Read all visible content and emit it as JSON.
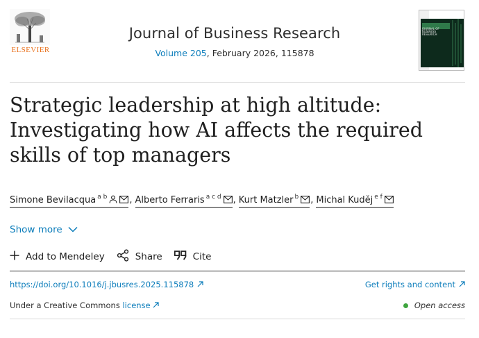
{
  "publisher": {
    "name": "ELSEVIER"
  },
  "journal": {
    "title": "Journal of Business Research",
    "volume_link": "Volume 205",
    "issue_info": ", February 2026, 115878",
    "cover_text": "JOURNAL OF BUSINESS RESEARCH"
  },
  "article": {
    "title_line1": "Strategic leadership at high altitude:",
    "title_line2": "Investigating how AI affects the required",
    "title_line3": "skills of top managers"
  },
  "authors": [
    {
      "name": "Simone Bevilacqua",
      "affiliations": "a b",
      "icons": [
        "person-icon",
        "email-icon"
      ]
    },
    {
      "name": "Alberto Ferraris",
      "affiliations": "a c d",
      "icons": [
        "email-icon"
      ]
    },
    {
      "name": "Kurt Matzler",
      "affiliations": "b",
      "icons": [
        "email-icon"
      ]
    },
    {
      "name": "Michal Kuděj",
      "affiliations": "e f",
      "icons": [
        "email-icon"
      ]
    }
  ],
  "author_separator": ",",
  "show_more_label": "Show more",
  "actions": {
    "mendeley": "Add to Mendeley",
    "share": "Share",
    "cite": "Cite"
  },
  "doi": "https://doi.org/10.1016/j.jbusres.2025.115878",
  "rights_label": "Get rights and content",
  "license": {
    "prefix": "Under a Creative Commons ",
    "link": "license"
  },
  "access": "Open access",
  "colors": {
    "link": "#0c7dbb",
    "publisher_orange": "#e9711c",
    "open_access_dot": "#3fa53f"
  }
}
